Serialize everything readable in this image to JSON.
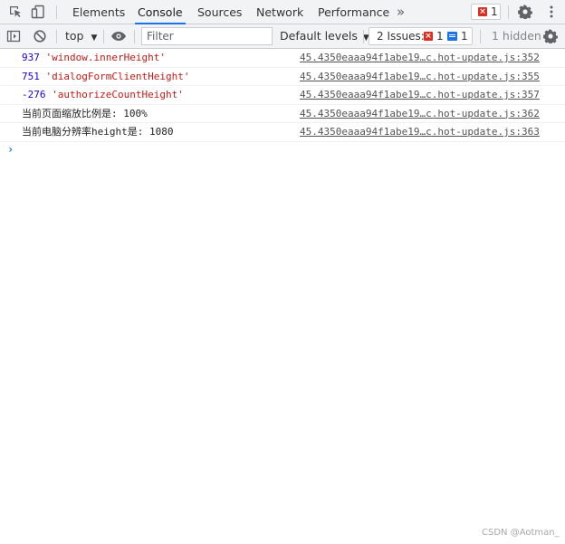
{
  "topbar": {
    "tabs": [
      {
        "label": "Elements",
        "active": false
      },
      {
        "label": "Console",
        "active": true
      },
      {
        "label": "Sources",
        "active": false
      },
      {
        "label": "Network",
        "active": false
      },
      {
        "label": "Performance",
        "active": false
      }
    ],
    "more_tabs_label": "»",
    "error_count": "1",
    "icons": [
      "inspect-element-icon",
      "device-toolbar-icon",
      "settings-gear-icon",
      "more-options-icon"
    ]
  },
  "toolbar": {
    "context": "top",
    "filter_placeholder": "Filter",
    "levels_label": "Default levels",
    "issues_label": "2 Issues:",
    "issues_error_count": "1",
    "issues_info_count": "1",
    "hidden_label": "1 hidden",
    "icons": [
      "sidebar-toggle-icon",
      "clear-console-icon",
      "live-expression-eye-icon",
      "console-settings-gear-icon"
    ]
  },
  "console": {
    "rows": [
      {
        "num": "937",
        "str": "'window.innerHeight'",
        "text": "",
        "source": "45.4350eaaa94f1abe19…c.hot-update.js:352"
      },
      {
        "num": "751",
        "str": "'dialogFormClientHeight'",
        "text": "",
        "source": "45.4350eaaa94f1abe19…c.hot-update.js:355"
      },
      {
        "num": "-276",
        "str": "'authorizeCountHeight'",
        "text": "",
        "source": "45.4350eaaa94f1abe19…c.hot-update.js:357"
      },
      {
        "num": "",
        "str": "",
        "text": "当前页面缩放比例是: 100%",
        "source": "45.4350eaaa94f1abe19…c.hot-update.js:362"
      },
      {
        "num": "",
        "str": "",
        "text": "当前电脑分辨率height是: 1080",
        "source": "45.4350eaaa94f1abe19…c.hot-update.js:363"
      }
    ],
    "prompt": "›"
  },
  "watermark": "CSDN @Aotman_",
  "colors": {
    "accent": "#1a73e8",
    "error": "#d93025",
    "number": "#1c00cf",
    "string": "#c41a16"
  }
}
